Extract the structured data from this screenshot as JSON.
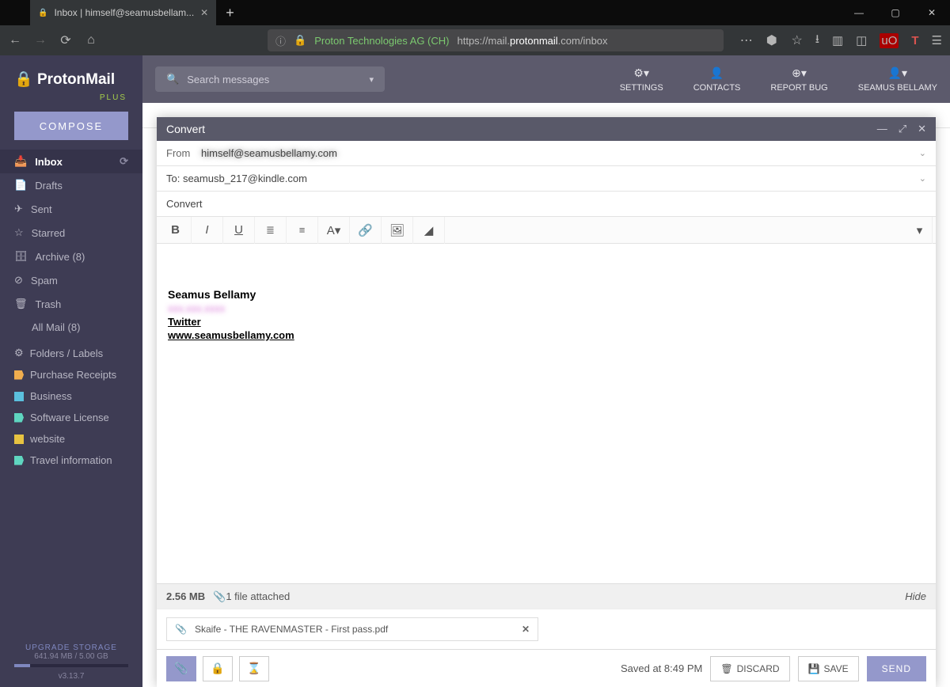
{
  "browser": {
    "tab_title": "Inbox | himself@seamusbellam...",
    "cert_issuer": "Proton Technologies AG (CH)",
    "url_prefix": "https://mail.",
    "url_domain": "protonmail",
    "url_suffix": ".com/inbox"
  },
  "brand": {
    "name": "ProtonMail",
    "tier": "PLUS"
  },
  "compose_button": "COMPOSE",
  "folders": [
    {
      "icon": "inbox",
      "label": "Inbox",
      "active": true,
      "refresh": true
    },
    {
      "icon": "file",
      "label": "Drafts"
    },
    {
      "icon": "send",
      "label": "Sent"
    },
    {
      "icon": "star",
      "label": "Starred"
    },
    {
      "icon": "archive",
      "label": "Archive  (8)"
    },
    {
      "icon": "ban",
      "label": "Spam"
    },
    {
      "icon": "trash",
      "label": "Trash"
    },
    {
      "icon": "",
      "label": "All Mail  (8)"
    }
  ],
  "folders_labels_header": "Folders / Labels",
  "labels": [
    {
      "color": "#f0ad4e",
      "label": "Purchase Receipts"
    },
    {
      "color": "#5bc0de",
      "label": "Business"
    },
    {
      "color": "#5fd6c0",
      "label": "Software License"
    },
    {
      "color": "#e8c341",
      "label": "website"
    },
    {
      "color": "#5fd6c0",
      "label": "Travel information"
    }
  ],
  "storage": {
    "upgrade": "UPGRADE STORAGE",
    "text": "641.94 MB / 5.00 GB",
    "version": "v3.13.7"
  },
  "search_placeholder": "Search messages",
  "topbar": {
    "settings": "SETTINGS",
    "contacts": "CONTACTS",
    "report": "REPORT BUG",
    "user": "SEAMUS BELLAMY"
  },
  "composer": {
    "title": "Convert",
    "from_label": "From",
    "from_value": "himself@seamusbellamy.com",
    "to_value": "To: seamusb_217@kindle.com",
    "subject": "Convert",
    "sig_name": "Seamus Bellamy",
    "sig_twitter": "Twitter",
    "sig_site": "www.seamusbellamy.com",
    "attach_size": "2.56 MB",
    "attach_count": "1 file attached",
    "attach_hide": "Hide",
    "attachment_name": "Skaife - THE RAVENMASTER - First pass.pdf",
    "saved": "Saved at 8:49 PM",
    "discard": "DISCARD",
    "save": "SAVE",
    "send": "SEND"
  }
}
